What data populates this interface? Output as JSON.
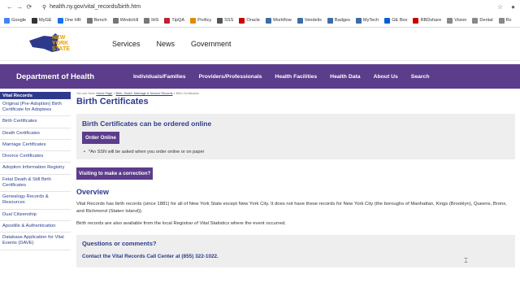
{
  "browser": {
    "url": "health.ny.gov/vital_records/birth.htm",
    "bookmarks": [
      {
        "label": "Google",
        "color": "#4285f4"
      },
      {
        "label": "MyGE",
        "color": "#333333"
      },
      {
        "label": "One HR",
        "color": "#1a73e8"
      },
      {
        "label": "Bench",
        "color": "#777777"
      },
      {
        "label": "Windchill",
        "color": "#777777"
      },
      {
        "label": "IHS",
        "color": "#777777"
      },
      {
        "label": "TipQA",
        "color": "#b23"
      },
      {
        "label": "Proficy",
        "color": "#e38b00"
      },
      {
        "label": "SSS",
        "color": "#555555"
      },
      {
        "label": "Oracle",
        "color": "#c00"
      },
      {
        "label": "Workflow",
        "color": "#3a6ea5"
      },
      {
        "label": "Vendelix",
        "color": "#3a6ea5"
      },
      {
        "label": "Badges",
        "color": "#3a6ea5"
      },
      {
        "label": "MyTech",
        "color": "#3a6ea5"
      },
      {
        "label": "GE Box",
        "color": "#0061d5"
      },
      {
        "label": "RBDshare",
        "color": "#c00"
      },
      {
        "label": "Vision",
        "color": "#888"
      },
      {
        "label": "Dental",
        "color": "#888"
      },
      {
        "label": "Rx",
        "color": "#888"
      }
    ]
  },
  "site": {
    "logo_text_1": "NEW",
    "logo_text_2": "YORK",
    "logo_text_3": "STATE",
    "topnav": [
      "Services",
      "News",
      "Government"
    ],
    "dept": "Department of Health",
    "mainnav": [
      "Individuals/Families",
      "Providers/Professionals",
      "Health Facilities",
      "Health Data",
      "About Us",
      "Search"
    ]
  },
  "sidebar": {
    "head": "Vital Records",
    "items": [
      "Original (Pre-Adoption) Birth Certificate for Adoptees",
      "Birth Certificates",
      "Death Certificates",
      "Marriage Certificates",
      "Divorce Certificates",
      "Adoption Information Registry",
      "Fetal Death & Still Birth Certificates",
      "Genealogy Records & Resources",
      "Dual Citizenship",
      "Apostille & Authentication",
      "Database Application for Vital Events (DAVE)"
    ]
  },
  "main": {
    "crumb_prefix": "You are Here:",
    "crumb_home": "Home Page",
    "crumb_mid": "Birth, Death, Marriage & Divorce Records",
    "crumb_current": "Birth Certificates",
    "title": "Birth Certificates",
    "order_heading": "Birth Certificates can be ordered online",
    "order_button": "Order Online",
    "ssn_note": "*An SSN will be asked when you order online or on paper",
    "correction_button": "Visiting to make a correction?",
    "overview_heading": "Overview",
    "overview_p1": "Vital Records has birth records (since 1881) for all of New York State except New York City. It does not have these records for New York City (the boroughs of Manhattan, Kings (Brooklyn), Queens, Bronx, and Richmond (Staten Island)).",
    "overview_p2": "Birth records are also available from the local Registrar of Vital Statistics where the event occurred.",
    "questions_heading": "Questions or comments?",
    "contact_line": "Contact the Vital Records Call Center at (855) 322-1022."
  }
}
